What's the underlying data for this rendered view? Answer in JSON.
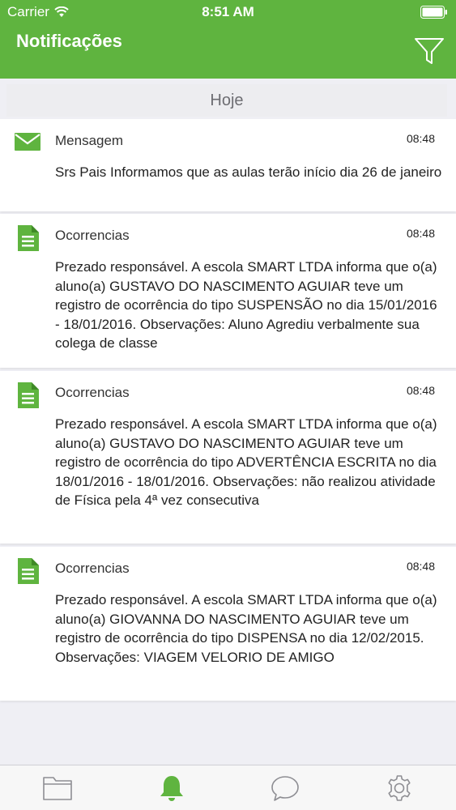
{
  "status_bar": {
    "carrier": "Carrier",
    "time": "8:51 AM"
  },
  "header": {
    "title": "Notificações",
    "filter_icon": "filter-icon"
  },
  "section": {
    "label": "Hoje"
  },
  "notifications": [
    {
      "type": "Mensagem",
      "icon": "envelope-icon",
      "time": "08:48",
      "body": "Srs Pais Informamos que as aulas terão início dia 26 de janeiro"
    },
    {
      "type": "Ocorrencias",
      "icon": "document-icon",
      "time": "08:48",
      "body": "Prezado responsável. A escola SMART LTDA informa que o(a) aluno(a) GUSTAVO DO NASCIMENTO AGUIAR teve um registro de ocorrência do tipo SUSPENSÃO no dia 15/01/2016 - 18/01/2016. Observações: Aluno Agrediu verbalmente sua colega de classe"
    },
    {
      "type": "Ocorrencias",
      "icon": "document-icon",
      "time": "08:48",
      "body": "Prezado responsável. A escola SMART LTDA informa que o(a) aluno(a) GUSTAVO DO NASCIMENTO AGUIAR teve um registro de ocorrência do tipo ADVERTÊNCIA ESCRITA no dia 18/01/2016 - 18/01/2016. Observações: não realizou atividade de Física pela 4ª vez consecutiva"
    },
    {
      "type": "Ocorrencias",
      "icon": "document-icon",
      "time": "08:48",
      "body": "Prezado responsável. A escola SMART LTDA informa que o(a) aluno(a) GIOVANNA DO NASCIMENTO AGUIAR teve um registro de ocorrência do tipo DISPENSA no dia 12/02/2015. Observações: VIAGEM VELORIO DE AMIGO"
    }
  ],
  "tabbar": {
    "tabs": [
      {
        "icon": "folder-icon",
        "active": false
      },
      {
        "icon": "bell-icon",
        "active": true
      },
      {
        "icon": "chat-bubble-icon",
        "active": false
      },
      {
        "icon": "gear-icon",
        "active": false
      }
    ]
  },
  "colors": {
    "brand": "#5fb43f",
    "inactive": "#8e8e93"
  }
}
